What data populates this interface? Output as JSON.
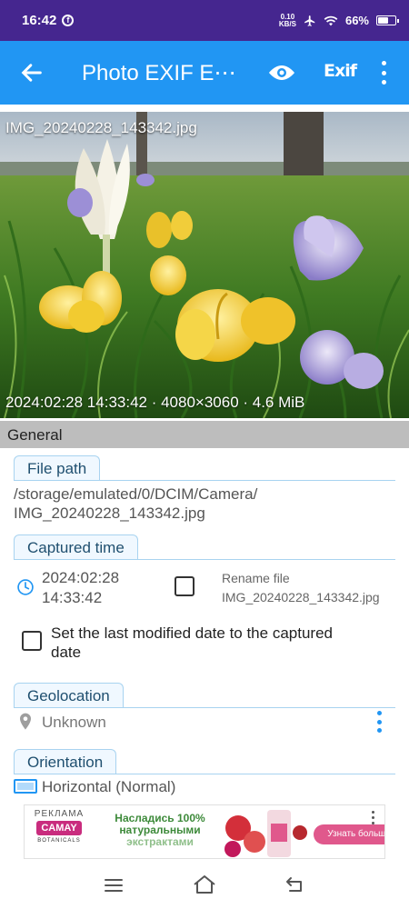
{
  "status_bar": {
    "time": "16:42",
    "net_speed": "0.10",
    "net_unit": "KB/S",
    "battery": "66%",
    "battery_level": 0.66
  },
  "app_bar": {
    "title": "Photo EXIF E⋯",
    "exif_label": "Exif"
  },
  "photo": {
    "filename": "IMG_20240228_143342.jpg",
    "meta": "2024:02:28 14:33:42 · 4080×3060 · 4.6 MiB"
  },
  "section": {
    "title": "General"
  },
  "file_path": {
    "label": "File path",
    "line1": "/storage/emulated/0/DCIM/Camera/",
    "line2": "IMG_20240228_143342.jpg"
  },
  "captured_time": {
    "label": "Captured time",
    "date": "2024:02:28",
    "time": "14:33:42",
    "rename_label": "Rename file",
    "rename_value": "IMG_20240228_143342.jpg",
    "set_modified_line1": "Set the last modified date to the captured",
    "set_modified_line2": "date"
  },
  "geolocation": {
    "label": "Geolocation",
    "value": "Unknown"
  },
  "orientation": {
    "label": "Orientation",
    "value": "Horizontal (Normal)"
  },
  "ad": {
    "tag": "РЕКЛАМА",
    "brand": "CAMAY",
    "sub": "BOTANICALS",
    "slogan_line1": "Насладись 100%",
    "slogan_line2": "натуральными",
    "slogan_line3": "экстрактами",
    "cta": "Узнать больше"
  },
  "colors": {
    "status_bar": "#45268f",
    "app_bar": "#2196f3",
    "section_header": "#bdbdbd",
    "tab_border": "#a8d3f0",
    "accent_icon": "#2196f3"
  }
}
